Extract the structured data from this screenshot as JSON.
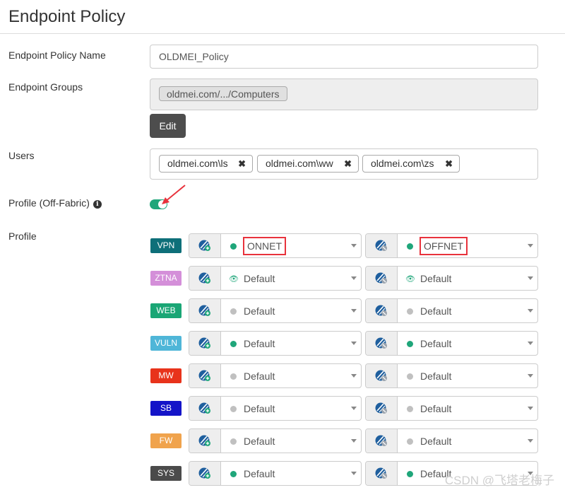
{
  "page": {
    "title": "Endpoint Policy"
  },
  "fields": {
    "policy_name_label": "Endpoint Policy Name",
    "policy_name_value": "OLDMEI_Policy",
    "groups_label": "Endpoint Groups",
    "groups": [
      "oldmei.com/.../Computers"
    ],
    "edit_label": "Edit",
    "users_label": "Users",
    "users": [
      "oldmei.com\\ls",
      "oldmei.com\\ww",
      "oldmei.com\\zs"
    ],
    "profile_offfabric_label": "Profile (Off-Fabric)",
    "profile_offfabric_enabled": true,
    "profile_label": "Profile"
  },
  "profiles": [
    {
      "name": "VPN",
      "color": "#0e6f79",
      "on": {
        "value": "ONNET",
        "indicator": "dot",
        "dot_color": "#1fa67a"
      },
      "off": {
        "value": "OFFNET",
        "indicator": "dot",
        "dot_color": "#1fa67a"
      }
    },
    {
      "name": "ZTNA",
      "color": "#d48fd9",
      "on": {
        "value": "Default",
        "indicator": "eye",
        "dot_color": "#1fa67a"
      },
      "off": {
        "value": "Default",
        "indicator": "eye",
        "dot_color": "#1fa67a"
      }
    },
    {
      "name": "WEB",
      "color": "#1aa675",
      "on": {
        "value": "Default",
        "indicator": "dot",
        "dot_color": "#c0c0c0"
      },
      "off": {
        "value": "Default",
        "indicator": "dot",
        "dot_color": "#c0c0c0"
      }
    },
    {
      "name": "VULN",
      "color": "#4fb6d8",
      "on": {
        "value": "Default",
        "indicator": "dot",
        "dot_color": "#1fa67a"
      },
      "off": {
        "value": "Default",
        "indicator": "dot",
        "dot_color": "#1fa67a"
      }
    },
    {
      "name": "MW",
      "color": "#e8331b",
      "on": {
        "value": "Default",
        "indicator": "dot",
        "dot_color": "#c0c0c0"
      },
      "off": {
        "value": "Default",
        "indicator": "dot",
        "dot_color": "#c0c0c0"
      }
    },
    {
      "name": "SB",
      "color": "#1414c8",
      "on": {
        "value": "Default",
        "indicator": "dot",
        "dot_color": "#c0c0c0"
      },
      "off": {
        "value": "Default",
        "indicator": "dot",
        "dot_color": "#c0c0c0"
      }
    },
    {
      "name": "FW",
      "color": "#f0a34c",
      "on": {
        "value": "Default",
        "indicator": "dot",
        "dot_color": "#c0c0c0"
      },
      "off": {
        "value": "Default",
        "indicator": "dot",
        "dot_color": "#c0c0c0"
      }
    },
    {
      "name": "SYS",
      "color": "#4b4b4b",
      "on": {
        "value": "Default",
        "indicator": "dot",
        "dot_color": "#1fa67a"
      },
      "off": {
        "value": "Default",
        "indicator": "dot",
        "dot_color": "#1fa67a"
      }
    }
  ],
  "highlighted_values": [
    "ONNET",
    "OFFNET"
  ],
  "watermark": "CSDN @飞塔老梅子"
}
